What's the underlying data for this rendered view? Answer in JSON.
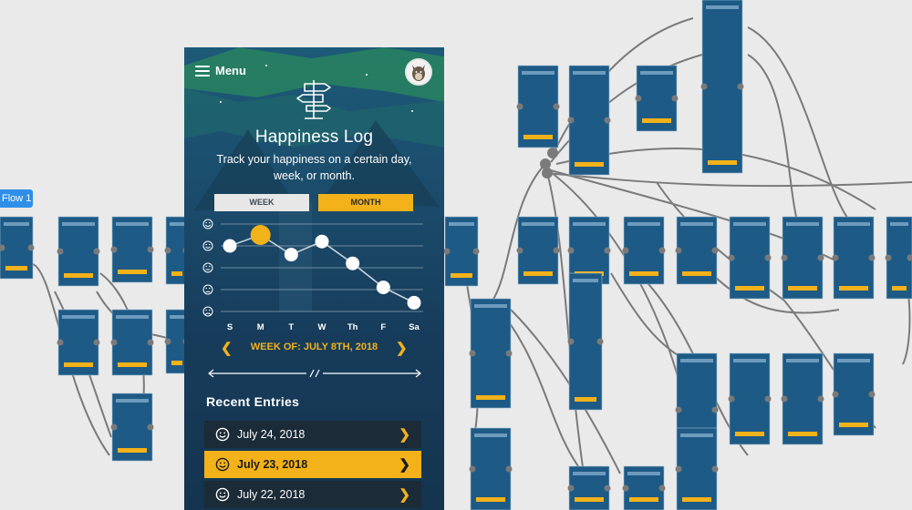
{
  "canvas": {
    "flow_tag": "Flow 1",
    "colors": {
      "background": "#eaeaea",
      "connector": "#7a7a7a",
      "screen": "#1e5a86",
      "accent": "#2f8fe8"
    }
  },
  "phone": {
    "menu_label": "Menu",
    "menu_icon": "hamburger-icon",
    "avatar_icon": "wolf-avatar-icon",
    "hero_icon": "signpost-icon",
    "title": "Happiness Log",
    "subtitle": "Track your happiness on a certain day, week, or month.",
    "toggles": {
      "week": "WEEK",
      "month": "MONTH",
      "active": "month"
    },
    "chart_data": {
      "type": "line",
      "categories": [
        "S",
        "M",
        "T",
        "W",
        "Th",
        "F",
        "Sa"
      ],
      "series": [
        {
          "values": [
            4,
            4.5,
            3.6,
            4.2,
            3.2,
            2.1,
            1.4
          ]
        }
      ],
      "highlight_index": 1,
      "ylim": [
        1,
        5
      ],
      "y_tick_icons": [
        "very-happy-face-icon",
        "happy-face-icon",
        "neutral-face-icon",
        "sad-face-icon",
        "very-sad-face-icon"
      ],
      "grid": true,
      "colors": {
        "point": "#ffffff",
        "highlight": "#f3b21a",
        "line": "#c8d2da",
        "grid": "#8fa3b3"
      }
    },
    "week_label": "WEEK OF: JULY 8TH, 2018",
    "recent_title": "Recent Entries",
    "entries": [
      {
        "label": "July 24, 2018",
        "mood": "happy-face-icon",
        "selected": false
      },
      {
        "label": "July 23, 2018",
        "mood": "happy-face-icon",
        "selected": true
      },
      {
        "label": "July 22, 2018",
        "mood": "happy-face-icon",
        "selected": false
      }
    ],
    "colors": {
      "accent": "#f3b21a",
      "toggle_inactive": "#e7e7e7",
      "entry_bg": "#1b2b38"
    }
  }
}
